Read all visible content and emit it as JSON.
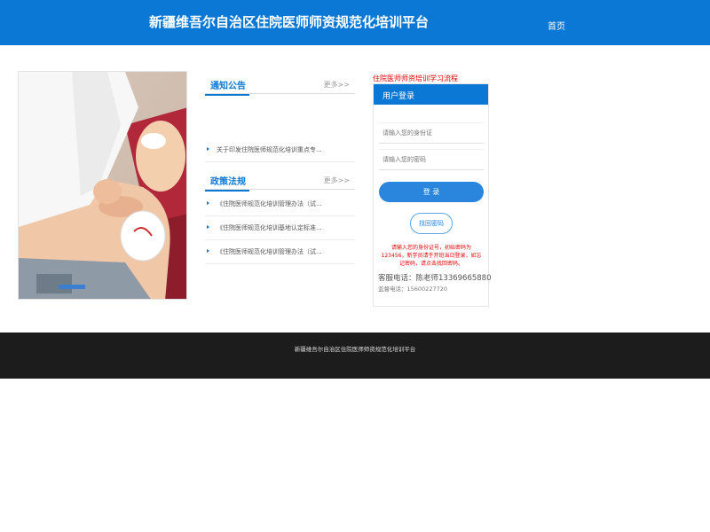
{
  "header": {
    "title": "新疆维吾尔自治区住院医师师资规范化培训平台",
    "nav_home": "首页"
  },
  "notice_section": {
    "title": "通知公告",
    "more": "更多>>",
    "items": [
      {
        "text": "关于印发住院医师规范化培训重点专..."
      }
    ]
  },
  "policy_section": {
    "title": "政策法规",
    "more": "更多>>",
    "items": [
      {
        "text": "《住院医师规范化培训管理办法（试..."
      },
      {
        "text": "《住院医师规范化培训基地认定标准..."
      },
      {
        "text": "《住院医师规范化培训管理办法（试..."
      }
    ]
  },
  "login": {
    "flow_link": "住院医师师资培训学习流程",
    "title": "用户登录",
    "id_placeholder": "请输入您的身份证",
    "password_placeholder": "请输入您的密码",
    "login_button": "登 录",
    "recover_button": "找回密码",
    "notice": "请输入您的身份证号，初始密码为123456，新学员请于开班当日登录，如忘记密码，请点击找回密码。",
    "phone": "客服电话：陈老师13369665880",
    "supervise": "监督电话：15600227720"
  },
  "footer": {
    "text": "新疆维吾尔自治区住院医师师资规范化培训平台"
  },
  "colors": {
    "primary": "#0a78d4",
    "button": "#2a86dd",
    "alert": "#e00000",
    "footer_bg": "#1c1c1c"
  }
}
